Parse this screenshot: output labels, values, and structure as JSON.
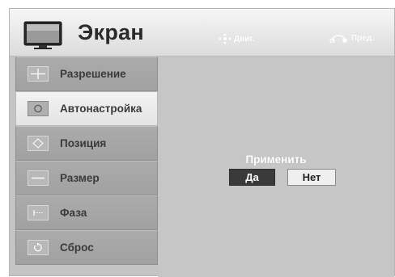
{
  "header": {
    "title": "Экран",
    "title_icon": "tv-icon",
    "hints": [
      {
        "icon": "move-icon",
        "label": "Двиг."
      },
      {
        "icon": "return-icon",
        "label": "Пред."
      }
    ]
  },
  "sidebar": {
    "items": [
      {
        "label": "Разрешение",
        "icon": "resolution-icon",
        "active": false
      },
      {
        "label": "Автонастройка",
        "icon": "auto-config-icon",
        "active": true
      },
      {
        "label": "Позиция",
        "icon": "position-icon",
        "active": false
      },
      {
        "label": "Размер",
        "icon": "size-icon",
        "active": false
      },
      {
        "label": "Фаза",
        "icon": "phase-icon",
        "active": false
      },
      {
        "label": "Сброс",
        "icon": "reset-icon",
        "active": false
      }
    ]
  },
  "dialog": {
    "prompt": "Применить",
    "yes_label": "Да",
    "no_label": "Нет",
    "selected": "yes"
  }
}
